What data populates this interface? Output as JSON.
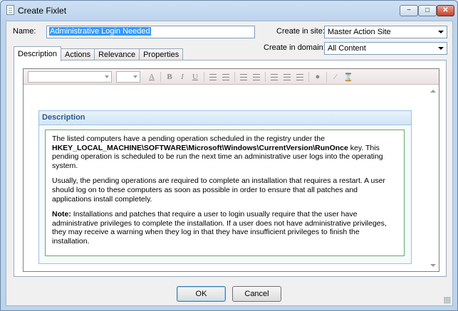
{
  "window": {
    "title": "Create Fixlet",
    "controls": {
      "minimize": "−",
      "maximize": "□",
      "close": "✕"
    }
  },
  "form": {
    "name_label": "Name:",
    "name_value": "Administrative Login Needed",
    "site_label": "Create in site:",
    "site_value": "Master Action Site",
    "domain_label": "Create in domain:",
    "domain_value": "All Content"
  },
  "tabs": [
    {
      "label": "Description",
      "active": true
    },
    {
      "label": "Actions",
      "active": false
    },
    {
      "label": "Relevance",
      "active": false
    },
    {
      "label": "Properties",
      "active": false
    }
  ],
  "toolbar": {
    "font_combo_value": "",
    "size_combo_value": "",
    "icons": [
      "font-color-icon",
      "bold-icon",
      "italic-icon",
      "underline-icon",
      "ordered-list-icon",
      "unordered-list-icon",
      "outdent-icon",
      "indent-icon",
      "align-left-icon",
      "align-center-icon",
      "align-right-icon",
      "insert-link-icon",
      "html-wand-icon",
      "clean-format-icon"
    ]
  },
  "description": {
    "header": "Description",
    "p1_before": "The listed computers have a pending operation scheduled in the registry under the ",
    "p1_key": "HKEY_LOCAL_MACHINE\\SOFTWARE\\Microsoft\\Windows\\CurrentVersion\\RunOnce",
    "p1_after": " key. This pending operation is scheduled to be run the next time an administrative user logs into the operating system.",
    "p2": "Usually, the pending operations are required to complete an installation that requires a restart. A user should log on to these computers as soon as possible in order to ensure that all patches and applications install completely.",
    "p3_label": "Note:",
    "p3": " Installations and patches that require a user to login usually require that the user have administrative privileges to complete the installation. If a user does not have administrative privileges, they may receive a warning when they log in that they have insufficient privileges to finish the installation."
  },
  "buttons": {
    "ok": "OK",
    "cancel": "Cancel"
  },
  "colors": {
    "accent": "#3399ff",
    "header_text": "#2b5a8c",
    "frame_border": "#6aa86a"
  }
}
